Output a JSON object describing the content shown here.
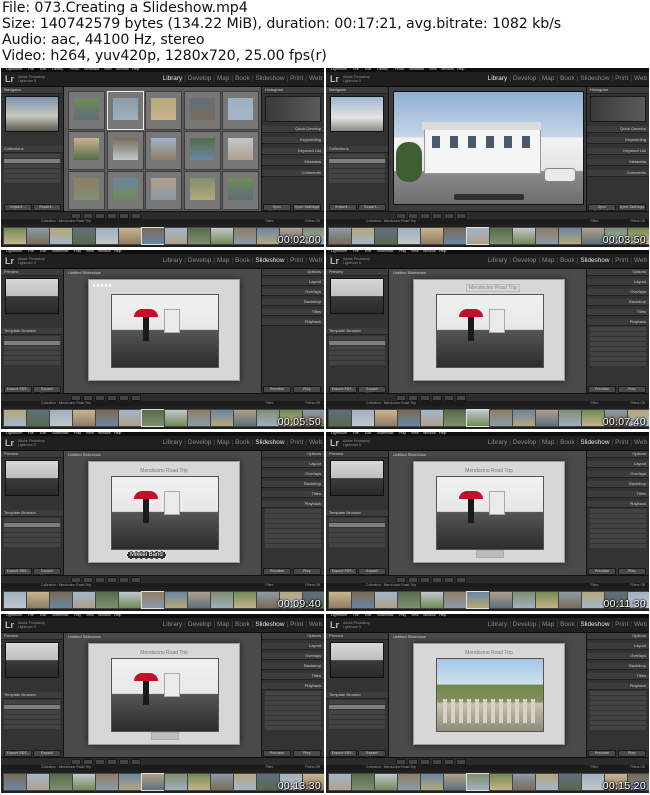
{
  "header": {
    "file": "File: 073.Creating a Slideshow.mp4",
    "size": "Size: 140742579 bytes (134.22 MiB), duration: 00:17:21, avg.bitrate: 1082 kb/s",
    "audio": "Audio: aac, 44100 Hz, stereo",
    "video": "Video: h264, yuv420p, 1280x720, 25.00 fps(r)"
  },
  "app": {
    "menu": [
      "Lightroom",
      "File",
      "Edit",
      "Library",
      "Photo",
      "Metadata",
      "View",
      "Window",
      "Help"
    ],
    "menu_slideshow": [
      "Lightroom",
      "File",
      "Edit",
      "Slideshow",
      "Play",
      "View",
      "Window",
      "Help"
    ],
    "logo": "Lr",
    "sub1": "Adobe Photoshop",
    "sub2": "Lightroom 5",
    "modules": [
      "Library",
      "Develop",
      "Map",
      "Book",
      "Slideshow",
      "Print",
      "Web"
    ]
  },
  "labels": {
    "navigator": "Navigator",
    "preview": "Preview",
    "template_browser": "Template Browser",
    "collections": "Collections",
    "histogram": "Histogram",
    "options": "Options",
    "untitled_slideshow": "Untitled Slideshow",
    "overlay_title": "Mendocino Road Trip",
    "identity_plate_text": "Mikkel Band",
    "export_pdf": "Export PDF...",
    "export_video": "Export Video...",
    "preview_btn": "Preview",
    "play_btn": "Play",
    "import": "Import...",
    "export": "Export...",
    "sync": "Sync Metadata",
    "sync_settings": "Sync Settings",
    "filter": "Filter:",
    "filters_off": "Filters Off",
    "collection_text": "Collection : Mendocino Road Trip"
  },
  "right_panels": {
    "library": [
      "Quick Develop",
      "Keywording",
      "Keyword List",
      "Metadata",
      "Comments"
    ],
    "slideshow": [
      "Options",
      "Layout",
      "Overlays",
      "Backdrop",
      "Titles",
      "Playback"
    ]
  },
  "templates": [
    "Lightroom Templates",
    "Caption and Rating",
    "Crop to Fill",
    "Default",
    "Exif Metadata",
    "Widescreen",
    "User Templates"
  ],
  "thumbs": [
    {
      "timestamp": "00:02:00",
      "module": "Library"
    },
    {
      "timestamp": "00:03:50",
      "module": "Library"
    },
    {
      "timestamp": "00:05:50",
      "module": "Slideshow"
    },
    {
      "timestamp": "00:07:40",
      "module": "Slideshow"
    },
    {
      "timestamp": "00:09:40",
      "module": "Slideshow"
    },
    {
      "timestamp": "00:11:30",
      "module": "Slideshow"
    },
    {
      "timestamp": "00:13:30",
      "module": "Slideshow"
    },
    {
      "timestamp": "00:15:20",
      "module": "Slideshow"
    }
  ],
  "colors": {
    "accent_umbrella": "#c0102b",
    "panel_bg": "#333333",
    "center_bg": "#4a4a4a"
  }
}
